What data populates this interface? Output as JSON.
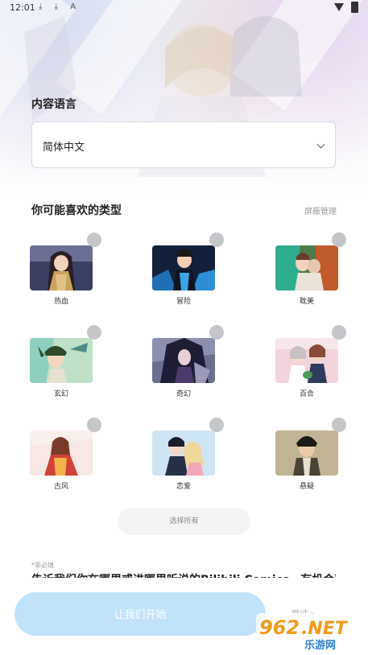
{
  "status_bar": {
    "time": "12:01",
    "left_icons": "⤓ ⤓ A"
  },
  "language": {
    "title": "内容语言",
    "selected": "简体中文"
  },
  "genres": {
    "title": "你可能喜欢的类型",
    "manage_label": "屏蔽管理",
    "items": [
      {
        "label": "热血"
      },
      {
        "label": "冒险"
      },
      {
        "label": "耽美"
      },
      {
        "label": "玄幻"
      },
      {
        "label": "奇幻"
      },
      {
        "label": "百合"
      },
      {
        "label": "古风"
      },
      {
        "label": "恋爱"
      },
      {
        "label": "悬疑"
      }
    ],
    "select_all_label": "选择所有"
  },
  "survey": {
    "required_note": "*非必填",
    "question": "告诉我们你在哪里或进哪里听说的Bilibili Comics，有机会获得"
  },
  "footer": {
    "start_label": "让我们开始",
    "skip_label": "跳过 »"
  },
  "watermark": {
    "brand": "962.NET",
    "subtitle": "乐游网"
  },
  "colors": {
    "accent": "#bfe3fb",
    "check_inactive": "#c5c6c9"
  }
}
